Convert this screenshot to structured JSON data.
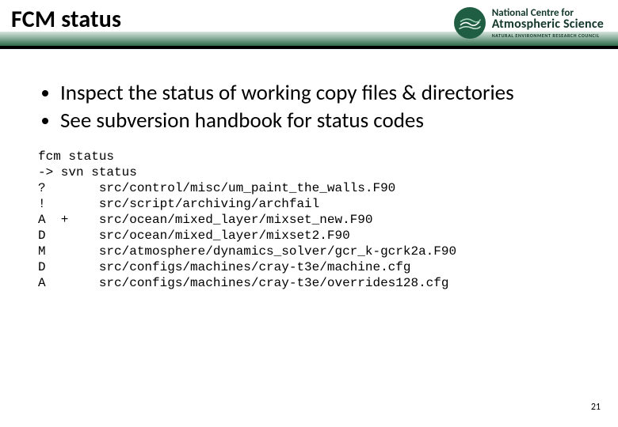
{
  "header": {
    "title": "FCM status",
    "logo": {
      "line1": "National Centre for",
      "line2": "Atmospheric Science",
      "sub": "NATURAL ENVIRONMENT RESEARCH COUNCIL",
      "icon_name": "ncas-globe-icon"
    }
  },
  "bullets": [
    "Inspect the status of working copy files & directories",
    "See subversion handbook for status codes"
  ],
  "code_lines": [
    "fcm status",
    "-> svn status",
    "?       src/control/misc/um_paint_the_walls.F90",
    "!       src/script/archiving/archfail",
    "A  +    src/ocean/mixed_layer/mixset_new.F90",
    "D       src/ocean/mixed_layer/mixset2.F90",
    "M       src/atmosphere/dynamics_solver/gcr_k-gcrk2a.F90",
    "D       src/configs/machines/cray-t3e/machine.cfg",
    "A       src/configs/machines/cray-t3e/overrides128.cfg"
  ],
  "page_number": "21"
}
